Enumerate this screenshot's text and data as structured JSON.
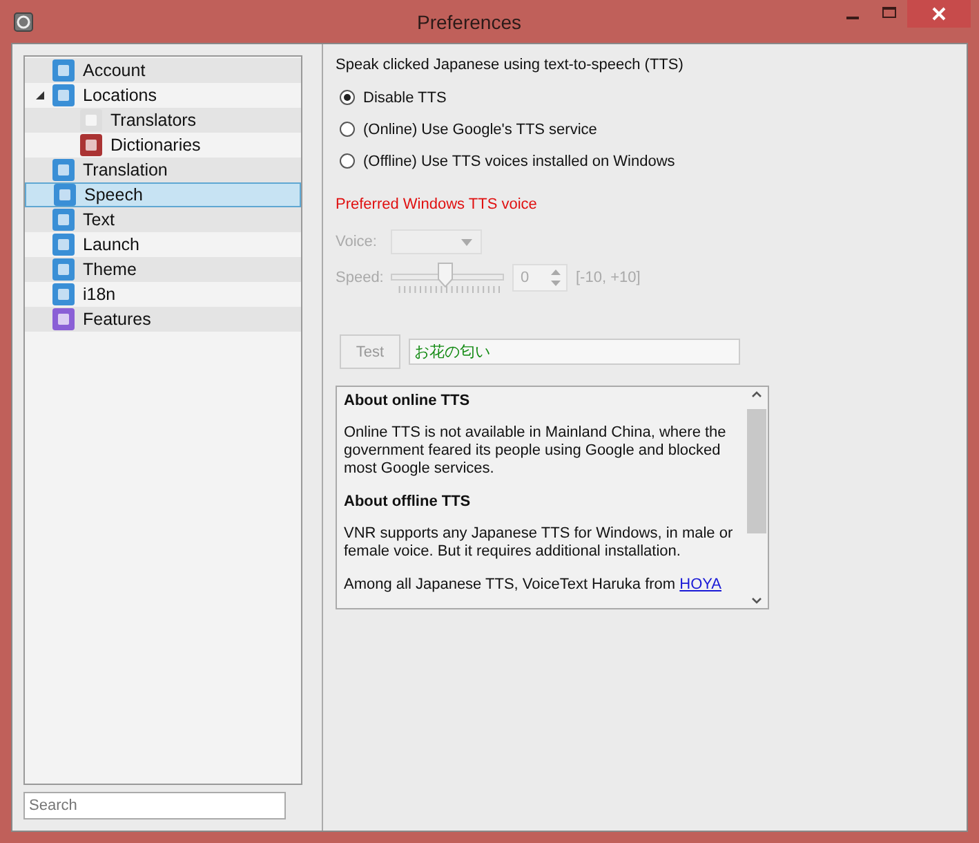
{
  "window": {
    "title": "Preferences"
  },
  "sidebar": {
    "items": [
      {
        "label": "Account",
        "selected": false
      },
      {
        "label": "Locations",
        "selected": false,
        "expanded": true,
        "children": [
          {
            "label": "Translators",
            "selected": false
          },
          {
            "label": "Dictionaries",
            "selected": false
          }
        ]
      },
      {
        "label": "Translation",
        "selected": false
      },
      {
        "label": "Speech",
        "selected": true
      },
      {
        "label": "Text",
        "selected": false
      },
      {
        "label": "Launch",
        "selected": false
      },
      {
        "label": "Theme",
        "selected": false
      },
      {
        "label": "i18n",
        "selected": false
      },
      {
        "label": "Features",
        "selected": false
      }
    ],
    "search": {
      "placeholder": "Search"
    }
  },
  "speech": {
    "heading": "Speak clicked Japanese using text-to-speech (TTS)",
    "options": [
      {
        "label": "Disable TTS",
        "selected": true
      },
      {
        "label": "(Online) Use Google's TTS service",
        "selected": false
      },
      {
        "label": "(Offline) Use TTS voices installed on Windows",
        "selected": false
      }
    ],
    "voice_heading": "Preferred Windows TTS voice",
    "voice": {
      "label": "Voice:",
      "disabled": true
    },
    "speed": {
      "label": "Speed:",
      "level": 0.47,
      "value": "0",
      "range": "[-10, +10]",
      "disabled": true
    },
    "test": {
      "label": "Test",
      "disabled": true,
      "value": "お花の匂い"
    },
    "info": [
      {
        "kind": "heading",
        "text": "About online TTS"
      },
      {
        "kind": "paragraph",
        "text": "Online TTS is not available in Mainland China, where the government feared its people using Google and blocked most Google services."
      },
      {
        "kind": "heading",
        "text": "About offline TTS"
      },
      {
        "kind": "paragraph",
        "text": "VNR supports any Japanese TTS for Windows, in male or female voice. But it requires additional installation."
      },
      {
        "kind": "paragraph",
        "text": "Among all Japanese TTS, VoiceText Haruka from",
        "link": "HOYA"
      }
    ]
  }
}
